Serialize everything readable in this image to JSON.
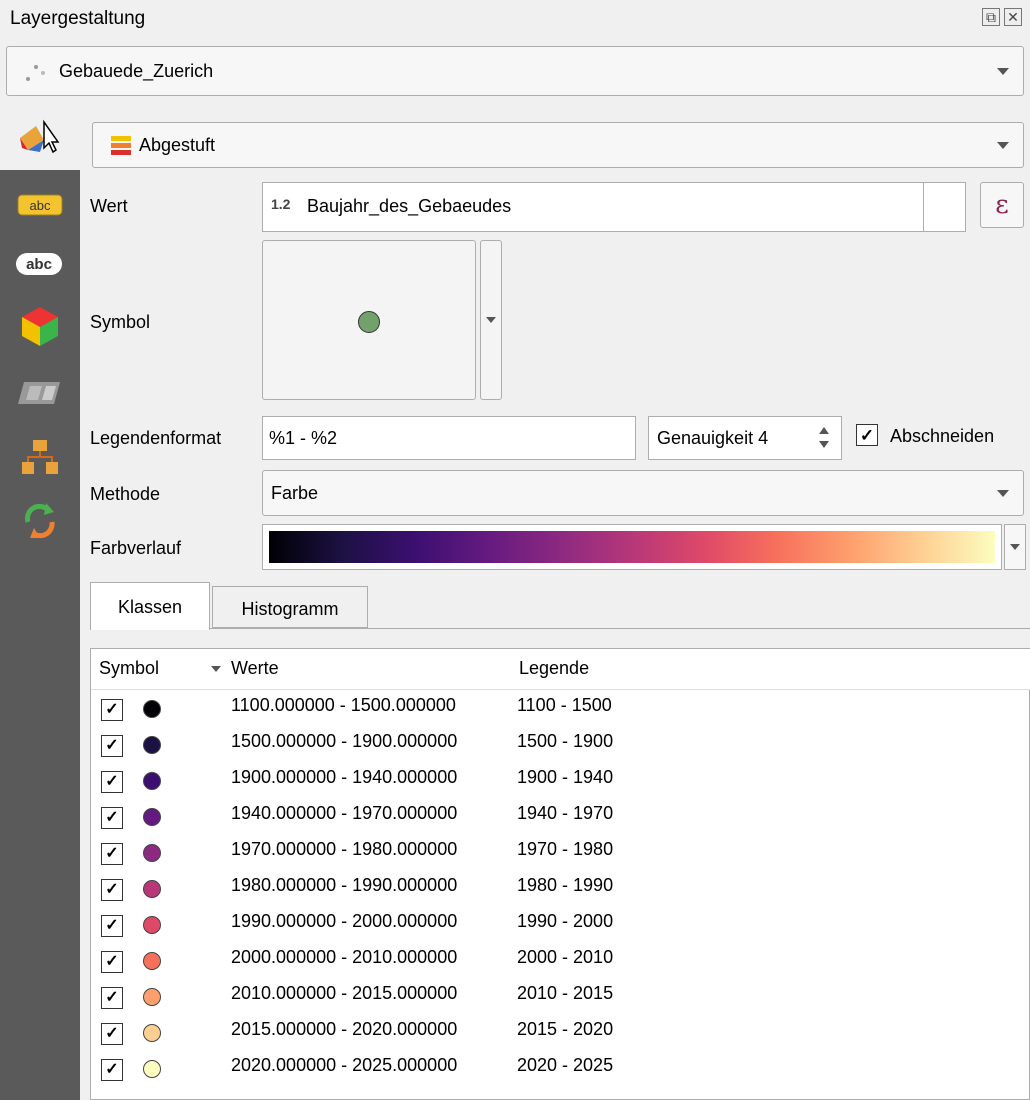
{
  "window": {
    "title": "Layergestaltung"
  },
  "layer": {
    "name": "Gebauede_Zuerich"
  },
  "renderer": {
    "label": "Abgestuft"
  },
  "labels": {
    "wert": "Wert",
    "symbol": "Symbol",
    "legendenformat": "Legendenformat",
    "methode": "Methode",
    "farbverlauf": "Farbverlauf"
  },
  "wert": {
    "type_badge": "1.2",
    "field": "Baujahr_des_Gebaeudes",
    "expr_glyph": "ε"
  },
  "symbol": {
    "color": "#72a16b"
  },
  "legendenformat": {
    "value": "%1 - %2"
  },
  "genauigkeit": {
    "label": "Genauigkeit 4"
  },
  "abschneiden": {
    "label": "Abschneiden",
    "checked": true
  },
  "methode": {
    "value": "Farbe"
  },
  "tabs": [
    {
      "label": "Klassen"
    },
    {
      "label": "Histogramm"
    }
  ],
  "table": {
    "headers": {
      "symbol": "Symbol",
      "werte": "Werte",
      "legende": "Legende"
    },
    "rows": [
      {
        "werte": "1100.000000 - 1500.000000",
        "legende": "1100 - 1500",
        "color": "#000004"
      },
      {
        "werte": "1500.000000 - 1900.000000",
        "legende": "1500 - 1900",
        "color": "#1c1143"
      },
      {
        "werte": "1900.000000 - 1940.000000",
        "legende": "1900 - 1940",
        "color": "#3b0f70"
      },
      {
        "werte": "1940.000000 - 1970.000000",
        "legende": "1940 - 1970",
        "color": "#641a80"
      },
      {
        "werte": "1970.000000 - 1980.000000",
        "legende": "1970 - 1980",
        "color": "#8c2981"
      },
      {
        "werte": "1980.000000 - 1990.000000",
        "legende": "1980 - 1990",
        "color": "#b73779"
      },
      {
        "werte": "1990.000000 - 2000.000000",
        "legende": "1990 - 2000",
        "color": "#de4968"
      },
      {
        "werte": "2000.000000 - 2010.000000",
        "legende": "2000 - 2010",
        "color": "#f7705c"
      },
      {
        "werte": "2010.000000 - 2015.000000",
        "legende": "2010 - 2015",
        "color": "#fe9f6d"
      },
      {
        "werte": "2015.000000 - 2020.000000",
        "legende": "2015 - 2020",
        "color": "#fecf92"
      },
      {
        "werte": "2020.000000 - 2025.000000",
        "legende": "2020 - 2025",
        "color": "#fcfdbf"
      }
    ]
  },
  "check_glyph": "✓",
  "colors": {
    "accent_sidebar": "#5a5a5a",
    "expr_color": "#8b2252"
  }
}
